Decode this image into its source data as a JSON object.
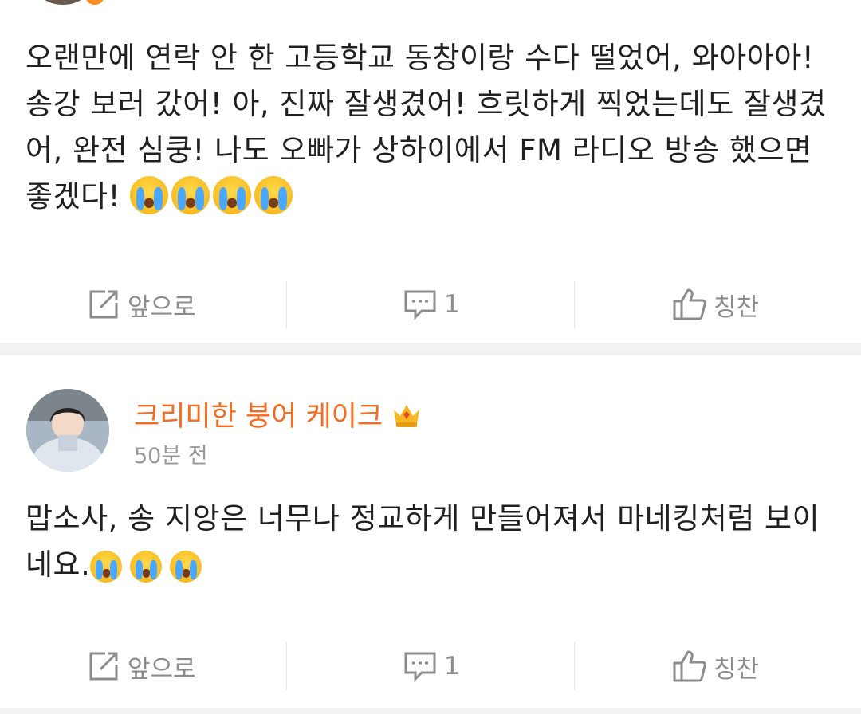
{
  "posts": [
    {
      "text": "오랜만에 연락 안 한 고등학교 동창이랑 수다 떨었어, 와아아아! 송강 보러 갔어! 아, 진짜 잘생겼어! 흐릿하게 찍었는데도 잘생겼어, 완전 심쿵! 나도 오빠가 상하이에서 FM 라디오 방송 했으면 좋겠다!",
      "emoji": [
        "crying-face",
        "crying-face",
        "crying-face",
        "crying-face"
      ],
      "actions": {
        "forward_label": "앞으로",
        "comment_count": "1",
        "like_label": "칭찬"
      }
    },
    {
      "username": "크리미한 붕어 케이크",
      "timestamp": "50분 전",
      "text": "맙소사, 송 지앙은 너무나 정교하게 만들어져서 마네킹처럼 보이네요.",
      "emoji": [
        "crying-face",
        "crying-face",
        "crying-face"
      ],
      "actions": {
        "forward_label": "앞으로",
        "comment_count": "1",
        "like_label": "칭찬"
      }
    }
  ],
  "colors": {
    "username": "#f56b1f",
    "muted": "#8c8c8c",
    "separator": "#f2f2f2"
  },
  "icons": {
    "forward": "share-edit-icon",
    "comment": "comment-bubble-icon",
    "like": "thumbs-up-icon",
    "crown": "vip-crown-icon"
  }
}
